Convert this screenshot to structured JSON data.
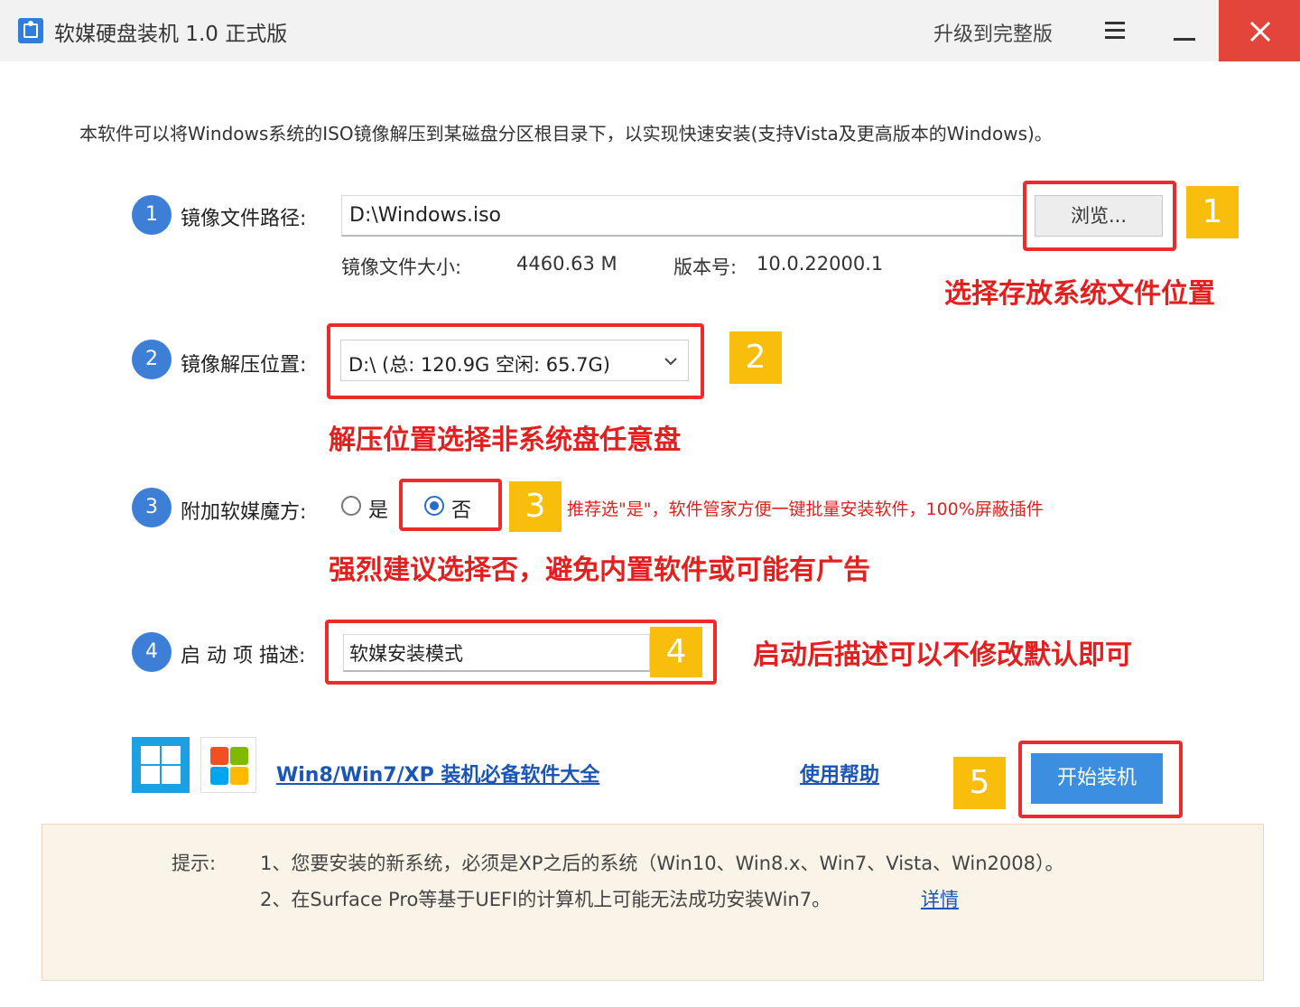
{
  "window": {
    "title": "软媒硬盘装机 1.0 正式版",
    "upgrade_label": "升级到完整版"
  },
  "description": "本软件可以将Windows系统的ISO镜像解压到某磁盘分区根目录下，以实现快速安装(支持Vista及更高版本的Windows)。",
  "steps": {
    "step1": {
      "number": "1",
      "label": "镜像文件路径:",
      "path_value": "D:\\Windows.iso",
      "browse_label": "浏览...",
      "size_label": "镜像文件大小:",
      "size_value": "4460.63 M",
      "version_label": "版本号:",
      "version_value": "10.0.22000.1"
    },
    "step2": {
      "number": "2",
      "label": "镜像解压位置:",
      "selected_value": "D:\\ (总: 120.9G 空闲: 65.7G)"
    },
    "step3": {
      "number": "3",
      "label": "附加软媒魔方:",
      "option_yes": "是",
      "option_no": "否",
      "selected": "否",
      "recommend_text": "推荐选\"是\"，软件管家方便一键批量安装软件，100%屏蔽插件"
    },
    "step4": {
      "number": "4",
      "label": "启 动 项 描述:",
      "description_value": "软媒安装模式"
    }
  },
  "annotations": {
    "tag1": "1",
    "tag2": "2",
    "tag3": "3",
    "tag4": "4",
    "tag5": "5",
    "note1": "选择存放系统文件位置",
    "note2": "解压位置选择非系统盘任意盘",
    "note3": "强烈建议选择否，避免内置软件或可能有广告",
    "note4": "启动后描述可以不修改默认即可"
  },
  "footer": {
    "software_link": "Win8/Win7/XP 装机必备软件大全",
    "help_link": "使用帮助",
    "start_label": "开始装机"
  },
  "tips": {
    "label": "提示:",
    "line1": "1、您要安装的新系统，必须是XP之后的系统（Win10、Win8.x、Win7、Vista、Win2008）。",
    "line2": "2、在Surface Pro等基于UEFI的计算机上可能无法成功安装Win7。",
    "detail_link": "详情"
  },
  "icons": {
    "app": "app-logo-icon",
    "menu": "hamburger-menu-icon",
    "minimize": "minimize-icon",
    "close": "close-icon",
    "dropdown": "chevron-down-icon",
    "windows8": "windows8-logo-icon",
    "windows7": "windows7-logo-icon"
  },
  "colors": {
    "accent": "#3d7fd6",
    "close_button": "#e4453a",
    "annotation_red": "#e3201f",
    "tag_yellow": "#f9bd0b",
    "tip_background": "#faf3e8",
    "link_blue": "#1a55b8"
  }
}
